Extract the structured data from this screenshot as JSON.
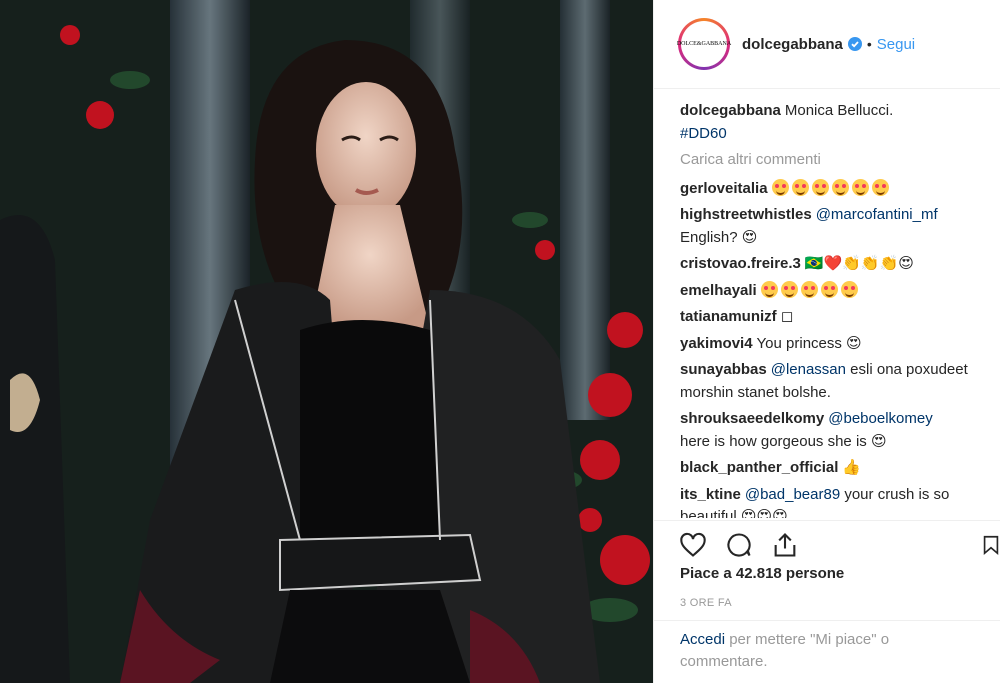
{
  "post": {
    "username": "dolcegabbana",
    "avatar_text": "DOLCE&GABBANA",
    "follow_label": "Segui",
    "caption": {
      "user": "dolcegabbana",
      "text": "Monica Bellucci.",
      "hashtag": "#DD60"
    },
    "load_more": "Carica altri commenti",
    "comments": [
      {
        "user": "gerloveitalia",
        "text": "",
        "emoji": "😍😍😍😍😍😍",
        "emoji_count": 6
      },
      {
        "user": "highstreetwhistles",
        "mention": "@marcofantini_mf",
        "text": "English? 😍"
      },
      {
        "user": "cristovao.freire.3",
        "text": "🇧🇷❤️👏👏👏😍"
      },
      {
        "user": "emelhayali",
        "emoji": "😍😍😍😍😍"
      },
      {
        "user": "tatianamunizf",
        "text": "◻"
      },
      {
        "user": "yakimovi4",
        "text": "You princess 😍"
      },
      {
        "user": "sunayabbas",
        "mention": "@lenassan",
        "text": "esli ona poxudeet morshin stanet bolshe."
      },
      {
        "user": "shrouksaeedelkomy",
        "mention": "@beboelkomey",
        "text": "here is how gorgeous she is 😍"
      },
      {
        "user": "black_panther_official",
        "text": "👍"
      },
      {
        "user": "its_ktine",
        "mention": "@bad_bear89",
        "text": "your crush is so beautiful 😍😍😍"
      }
    ],
    "likes": "Piace a 42.818 persone",
    "timestamp": "3 ORE FA",
    "login_link": "Accedi",
    "login_text": " per mettere \"Mi piace\" o commentare."
  },
  "colors": {
    "link": "#3897f0",
    "mention": "#003569",
    "muted": "#999999"
  },
  "icons": [
    "verified-badge-icon",
    "heart-icon",
    "comment-icon",
    "share-icon",
    "bookmark-icon"
  ]
}
